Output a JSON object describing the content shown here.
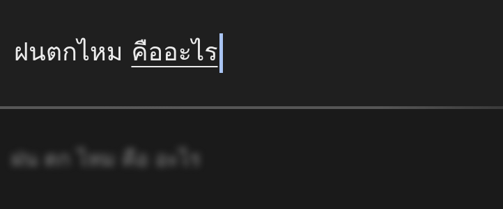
{
  "input": {
    "typed_text": "ฝนตกไหม",
    "composing_text": "คืออะไร"
  },
  "suggestion_bar": {
    "suggestion_text": "ฝน ตก ไหม คือ อะไร"
  },
  "colors": {
    "background": "#1f1f1f",
    "text": "#ececec",
    "caret": "#a9c4f2",
    "divider": "#575757"
  }
}
